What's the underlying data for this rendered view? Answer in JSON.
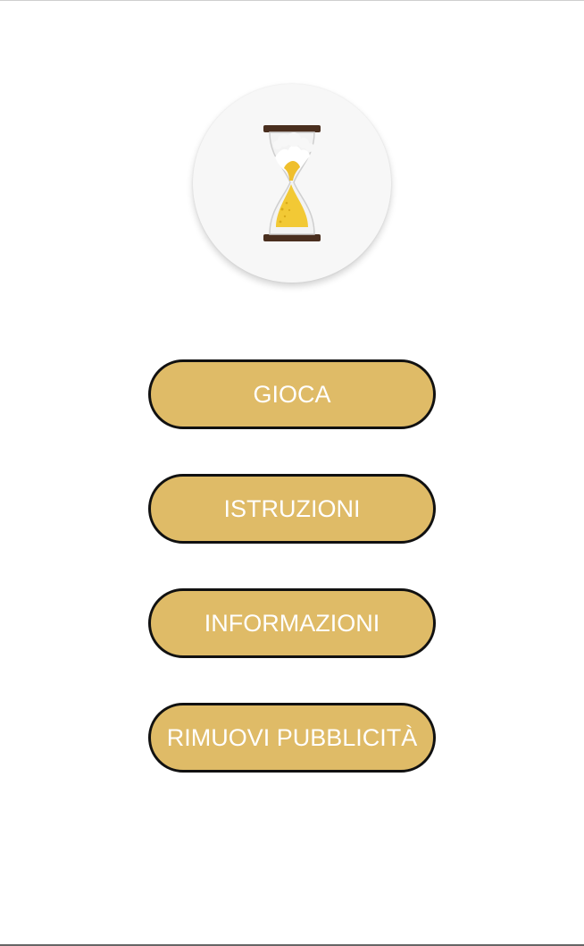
{
  "app": {
    "logo_icon": "hourglass-beer-icon"
  },
  "menu": {
    "buttons": [
      {
        "label": "GIOCA"
      },
      {
        "label": "ISTRUZIONI"
      },
      {
        "label": "INFORMAZIONI"
      },
      {
        "label": "RIMUOVI PUBBLICITÀ"
      }
    ]
  },
  "colors": {
    "button_fill": "#dfbb67",
    "button_border": "#111111",
    "button_text": "#ffffff",
    "background": "#ffffff"
  }
}
